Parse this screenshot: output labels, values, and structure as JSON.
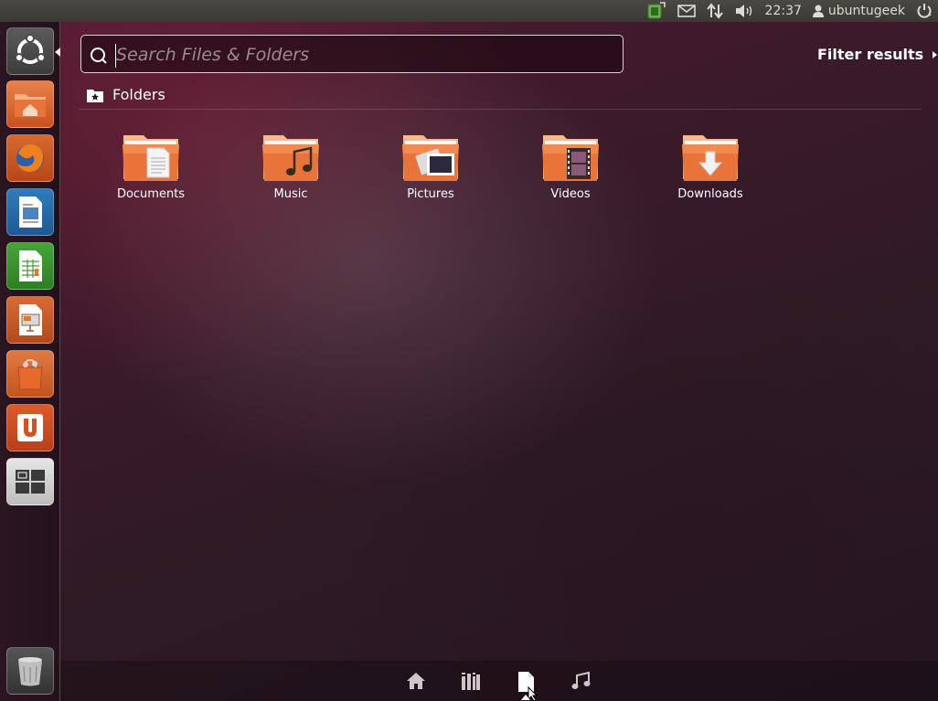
{
  "panel": {
    "clock": "22:37",
    "user": "ubuntugeek"
  },
  "launcher": {
    "items": [
      {
        "name": "Dash home"
      },
      {
        "name": "Home Folder"
      },
      {
        "name": "Firefox Web Browser"
      },
      {
        "name": "LibreOffice Writer"
      },
      {
        "name": "LibreOffice Calc"
      },
      {
        "name": "LibreOffice Impress"
      },
      {
        "name": "Ubuntu Software Center"
      },
      {
        "name": "Ubuntu One"
      },
      {
        "name": "Workspace Switcher"
      },
      {
        "name": "Trash"
      }
    ]
  },
  "search": {
    "placeholder": "Search Files & Folders",
    "value": ""
  },
  "filter": {
    "label": "Filter results"
  },
  "section": {
    "title": "Folders"
  },
  "folders": [
    {
      "label": "Documents",
      "icon": "documents-folder-icon"
    },
    {
      "label": "Music",
      "icon": "music-folder-icon"
    },
    {
      "label": "Pictures",
      "icon": "pictures-folder-icon"
    },
    {
      "label": "Videos",
      "icon": "videos-folder-icon"
    },
    {
      "label": "Downloads",
      "icon": "downloads-folder-icon"
    }
  ],
  "lenses": [
    {
      "name": "home-lens-icon"
    },
    {
      "name": "applications-lens-icon"
    },
    {
      "name": "files-lens-icon",
      "active": true
    },
    {
      "name": "music-lens-icon"
    }
  ],
  "colors": {
    "accent": "#e1642f",
    "dash_tint": "#3c1a2a"
  }
}
